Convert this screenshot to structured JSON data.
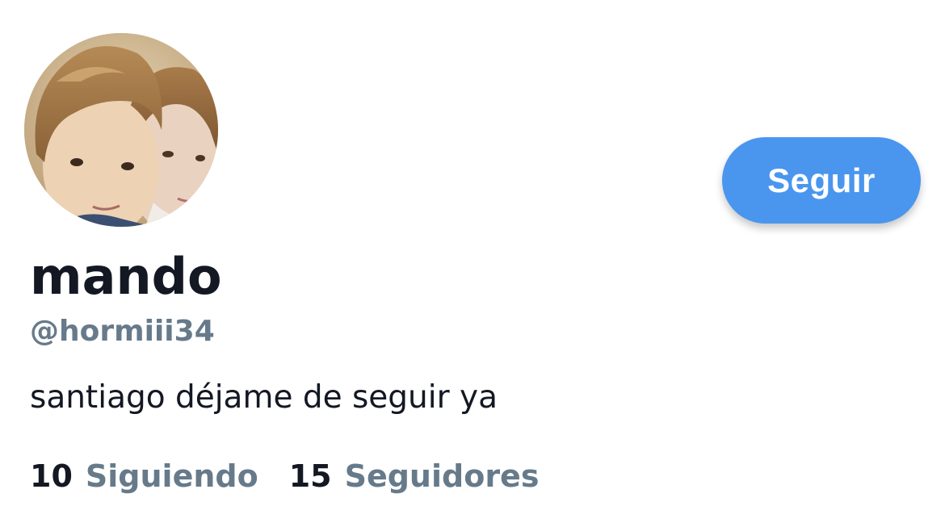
{
  "profile": {
    "display_name": "mando",
    "username": "@hormiii34",
    "bio": "santiago déjame de seguir ya",
    "follow_button_label": "Seguir",
    "stats": {
      "following_count": "10",
      "following_label": "Siguiendo",
      "followers_count": "15",
      "followers_label": "Seguidores"
    }
  },
  "colors": {
    "accent": "#4a96ee",
    "text_primary": "#141823",
    "text_secondary": "#667a8a",
    "background": "#ffffff"
  },
  "icons": {
    "avatar": "profile-photo"
  }
}
